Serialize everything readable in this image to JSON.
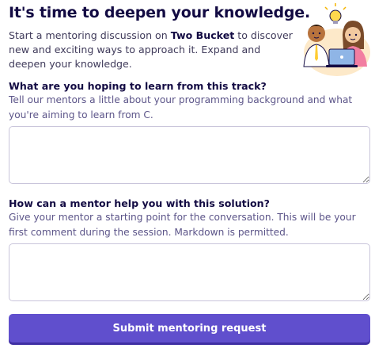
{
  "header": {
    "title": "It's time to deepen your knowledge.",
    "intro_prefix": "Start a mentoring discussion on ",
    "track_name": "Two Bucket",
    "intro_suffix": " to discover new and exciting ways to approach it. Expand and deepen your knowledge."
  },
  "question_one": {
    "title": "What are you hoping to learn from this track?",
    "description": "Tell our mentors a little about your programming background and what you're aiming to learn from C.",
    "value": ""
  },
  "question_two": {
    "title": "How can a mentor help you with this solution?",
    "description": "Give your mentor a starting point for the conversation. This will be your first comment during the session. Markdown is permitted.",
    "value": ""
  },
  "submit": {
    "label": "Submit mentoring request"
  },
  "colors": {
    "accent": "#604fcd",
    "heading": "#130b43",
    "muted": "#5c5589"
  },
  "icons": {
    "illustration": "mentoring-illustration"
  }
}
